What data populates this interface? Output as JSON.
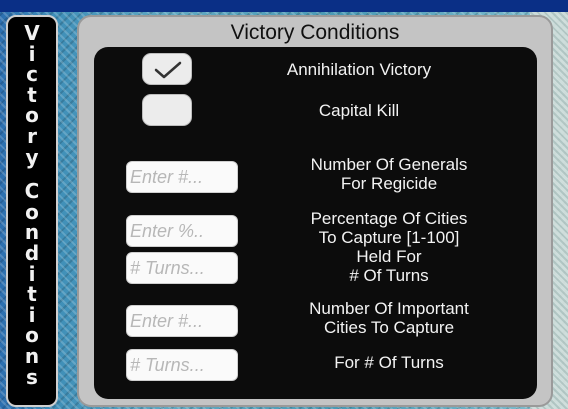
{
  "side_tab": {
    "letters": [
      "V",
      "i",
      "c",
      "t",
      "o",
      "r",
      "y",
      " ",
      "C",
      "o",
      "n",
      "d",
      "i",
      "t",
      "i",
      "o",
      "n",
      "s"
    ]
  },
  "panel": {
    "title": "Victory Conditions",
    "options": [
      {
        "label": "Annihilation Victory",
        "checked": true
      },
      {
        "label": "Capital Kill",
        "checked": false
      }
    ],
    "fields": [
      {
        "placeholder": "Enter #...",
        "label_line1": "Number Of Generals",
        "label_line2": "For Regicide"
      },
      {
        "placeholder": "Enter %..",
        "label_line1": "Percentage Of Cities",
        "label_line2": "To Capture [1-100]"
      },
      {
        "placeholder": "# Turns...",
        "label_line1": "Held For",
        "label_line2": "# Of Turns"
      },
      {
        "placeholder": "Enter #...",
        "label_line1": "Number Of Important",
        "label_line2": "Cities To Capture"
      },
      {
        "placeholder": "# Turns...",
        "label_line1": "For # Of Turns",
        "label_line2": ""
      }
    ]
  }
}
